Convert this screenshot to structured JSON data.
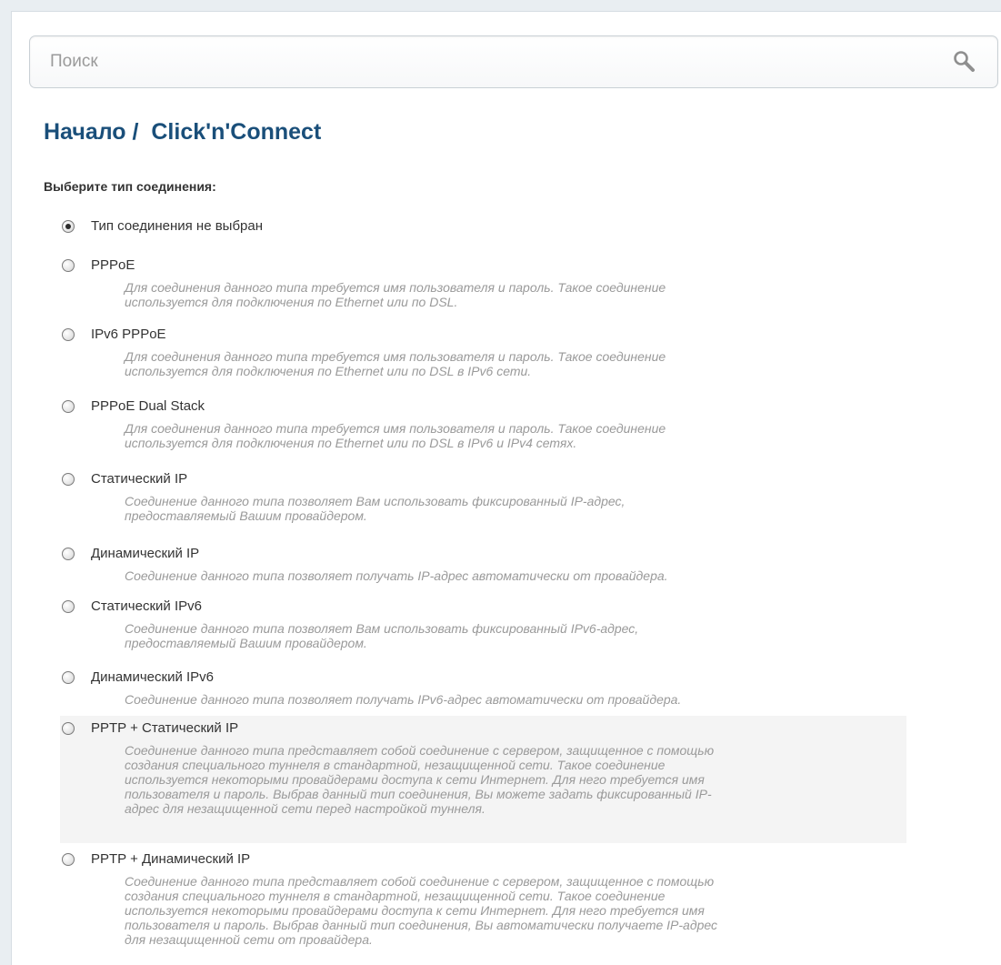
{
  "search": {
    "placeholder": "Поиск",
    "icon": "search-icon"
  },
  "breadcrumb": {
    "home": "Начало",
    "separator": " /  ",
    "current": "Click'n'Connect"
  },
  "connection": {
    "prompt": "Выберите тип соединения:",
    "selected_index": 0,
    "options": [
      {
        "label": "Тип соединения не выбран",
        "desc": []
      },
      {
        "label": "PPPoE",
        "desc": [
          "Для соединения данного типа требуется имя пользователя и пароль. Такое соединение",
          "используется для подключения по Ethernet или по DSL."
        ]
      },
      {
        "label": "IPv6 PPPoE",
        "desc": [
          "Для соединения данного типа требуется имя пользователя и пароль. Такое соединение",
          "используется для подключения по Ethernet или по DSL в IPv6 сети."
        ]
      },
      {
        "label": "PPPoE Dual Stack",
        "desc": [
          "Для соединения данного типа требуется имя пользователя и пароль. Такое соединение",
          "используется для подключения по Ethernet или по DSL в IPv6 и IPv4 сетях."
        ]
      },
      {
        "label": "Статический IP",
        "desc": [
          "Соединение данного типа позволяет Вам использовать фиксированный IP-адрес,",
          "предоставляемый Вашим провайдером."
        ]
      },
      {
        "label": "Динамический IP",
        "desc": [
          "Соединение данного типа позволяет получать IP-адрес автоматически от провайдера."
        ]
      },
      {
        "label": "Статический IPv6",
        "desc": [
          "Соединение данного типа позволяет Вам использовать фиксированный IPv6-адрес,",
          "предоставляемый Вашим провайдером."
        ]
      },
      {
        "label": "Динамический IPv6",
        "desc": [
          "Соединение данного типа позволяет получать IPv6-адрес автоматически от провайдера."
        ]
      },
      {
        "label": "PPTP + Статический IP",
        "desc": [
          "Соединение данного типа представляет собой соединение с сервером, защищенное с помощью",
          "создания специального туннеля в стандартной, незащищенной сети. Такое соединение",
          "используется некоторыми провайдерами доступа к сети Интернет. Для него требуется имя",
          "пользователя и пароль. Выбрав данный тип соединения, Вы можете задать фиксированный IP-",
          "адрес для незащищенной сети перед настройкой туннеля."
        ]
      },
      {
        "label": "PPTP + Динамический IP",
        "desc": [
          "Соединение данного типа представляет собой соединение с сервером, защищенное с помощью",
          "создания специального туннеля в стандартной, незащищенной сети. Такое соединение",
          "используется некоторыми провайдерами доступа к сети Интернет. Для него требуется имя",
          "пользователя и пароль. Выбрав данный тип соединения, Вы автоматически получаете IP-адрес",
          "для незащищенной сети от провайдера."
        ]
      }
    ]
  }
}
